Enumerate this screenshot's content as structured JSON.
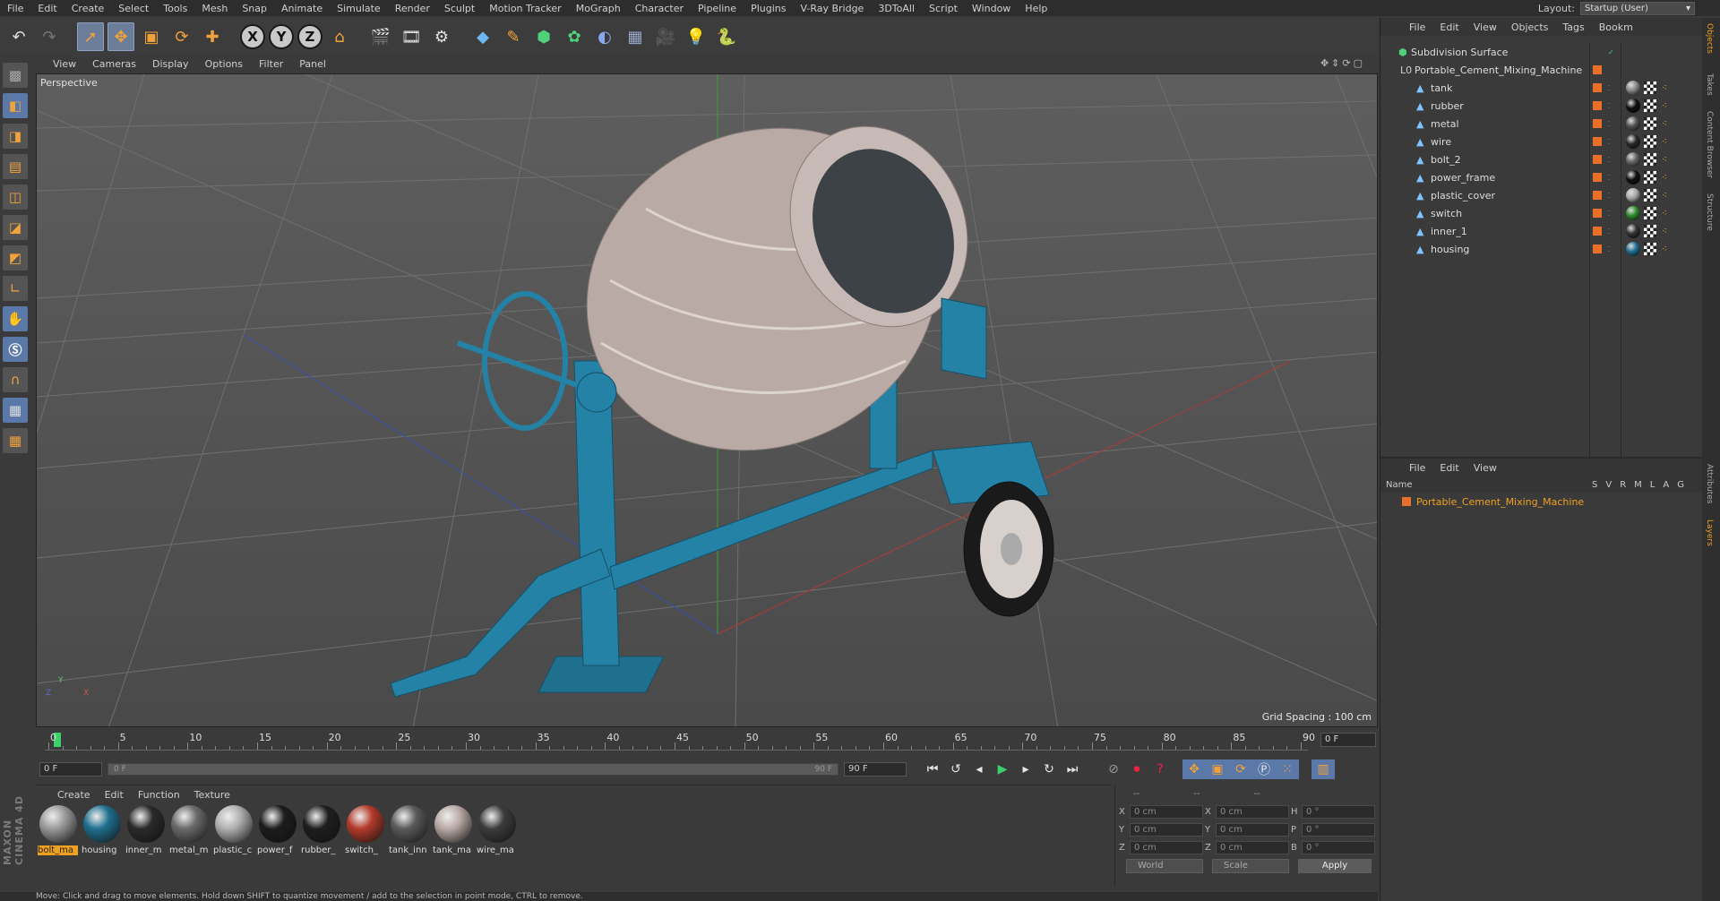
{
  "menubar": {
    "items": [
      "File",
      "Edit",
      "Create",
      "Select",
      "Tools",
      "Mesh",
      "Snap",
      "Animate",
      "Simulate",
      "Render",
      "Sculpt",
      "Motion Tracker",
      "MoGraph",
      "Character",
      "Pipeline",
      "Plugins",
      "V-Ray Bridge",
      "3DToAll",
      "Script",
      "Window",
      "Help"
    ],
    "layout_label": "Layout:",
    "layout_value": "Startup (User)"
  },
  "toolbar": {
    "axis_x": "X",
    "axis_y": "Y",
    "axis_z": "Z"
  },
  "viewport": {
    "menu": [
      "View",
      "Cameras",
      "Display",
      "Options",
      "Filter",
      "Panel"
    ],
    "label": "Perspective",
    "grid_spacing": "Grid Spacing : 100 cm",
    "axis_y": "Y",
    "axis_z": "Z",
    "axis_x": "X"
  },
  "timeline": {
    "ticks": [
      0,
      5,
      10,
      15,
      20,
      25,
      30,
      35,
      40,
      45,
      50,
      55,
      60,
      65,
      70,
      75,
      80,
      85,
      90
    ],
    "current_frame": "0 F"
  },
  "transport": {
    "start_frame": "0 F",
    "range_start": "0 F",
    "range_end": "90 F",
    "end_frame": "90 F"
  },
  "materials": {
    "menu": [
      "Create",
      "Edit",
      "Function",
      "Texture"
    ],
    "items": [
      {
        "name": "bolt_ma",
        "color": "#9a9a9a"
      },
      {
        "name": "housing",
        "color": "#1f6f8f"
      },
      {
        "name": "inner_m",
        "color": "#2a2a2a"
      },
      {
        "name": "metal_m",
        "color": "#6a6a6a"
      },
      {
        "name": "plastic_c",
        "color": "#b0b0b0"
      },
      {
        "name": "power_f",
        "color": "#1c1c1c"
      },
      {
        "name": "rubber_",
        "color": "#1e1e1e"
      },
      {
        "name": "switch_",
        "color": "#b33a2a"
      },
      {
        "name": "tank_inn",
        "color": "#5a5a5a"
      },
      {
        "name": "tank_ma",
        "color": "#b9aaa6"
      },
      {
        "name": "wire_ma",
        "color": "#3c3c3c"
      }
    ]
  },
  "coords": {
    "headers": [
      "--",
      "--",
      "--"
    ],
    "rows": [
      {
        "a1": "X",
        "v1": "0 cm",
        "a2": "X",
        "v2": "0 cm",
        "a3": "H",
        "v3": "0 °"
      },
      {
        "a1": "Y",
        "v1": "0 cm",
        "a2": "Y",
        "v2": "0 cm",
        "a3": "P",
        "v3": "0 °"
      },
      {
        "a1": "Z",
        "v1": "0 cm",
        "a2": "Z",
        "v2": "0 cm",
        "a3": "B",
        "v3": "0 °"
      }
    ],
    "world": "World",
    "scale": "Scale",
    "apply": "Apply"
  },
  "status": "Move: Click and drag to move elements. Hold down SHIFT to quantize movement / add to the selection in point mode, CTRL to remove.",
  "objects": {
    "menu": [
      "File",
      "Edit",
      "View",
      "Objects",
      "Tags",
      "Bookm"
    ],
    "root": "Subdivision Surface",
    "group": "Portable_Cement_Mixing_Machine",
    "children": [
      {
        "name": "tank",
        "tag": "#8a8a8a"
      },
      {
        "name": "rubber",
        "tag": "#111111"
      },
      {
        "name": "metal",
        "tag": "#555555"
      },
      {
        "name": "wire",
        "tag": "#2a2a2a"
      },
      {
        "name": "bolt_2",
        "tag": "#666666"
      },
      {
        "name": "power_frame",
        "tag": "#111111"
      },
      {
        "name": "plastic_cover",
        "tag": "#aaaaaa"
      },
      {
        "name": "switch",
        "tag": "#2e8b2e"
      },
      {
        "name": "inner_1",
        "tag": "#333333"
      },
      {
        "name": "housing",
        "tag": "#1f6f8f"
      }
    ]
  },
  "layers": {
    "menu": [
      "File",
      "Edit",
      "View"
    ],
    "col_name": "Name",
    "cols": [
      "S",
      "V",
      "R",
      "M",
      "L",
      "A",
      "G"
    ],
    "row": "Portable_Cement_Mixing_Machine"
  },
  "side_tabs": [
    "Objects",
    "Takes",
    "Content Browser",
    "Structure",
    "Attributes",
    "Layers"
  ],
  "brand": "MAXON CINEMA 4D"
}
